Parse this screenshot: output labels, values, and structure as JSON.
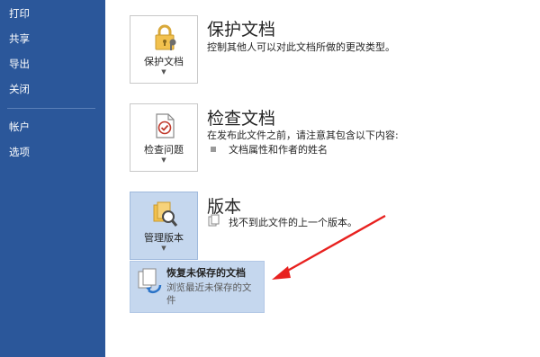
{
  "sidebar": {
    "items": [
      {
        "label": "打印"
      },
      {
        "label": "共享"
      },
      {
        "label": "导出"
      },
      {
        "label": "关闭"
      },
      {
        "label": "帐户"
      },
      {
        "label": "选项"
      }
    ]
  },
  "protect": {
    "button_label": "保护文档",
    "title": "保护文档",
    "description": "控制其他人可以对此文档所做的更改类型。"
  },
  "inspect": {
    "button_label": "检查问题",
    "title": "检查文档",
    "description": "在发布此文件之前，请注意其包含以下内容:",
    "bullets": [
      "文档属性和作者的姓名"
    ]
  },
  "versions": {
    "button_label": "管理版本",
    "title": "版本",
    "description": "找不到此文件的上一个版本。"
  },
  "dropdown": {
    "title": "恢复未保存的文档",
    "description": "浏览最近未保存的文件"
  },
  "colors": {
    "sidebar": "#2b579a",
    "highlight": "#c5d7ee",
    "annotation_arrow": "#e8211f"
  }
}
